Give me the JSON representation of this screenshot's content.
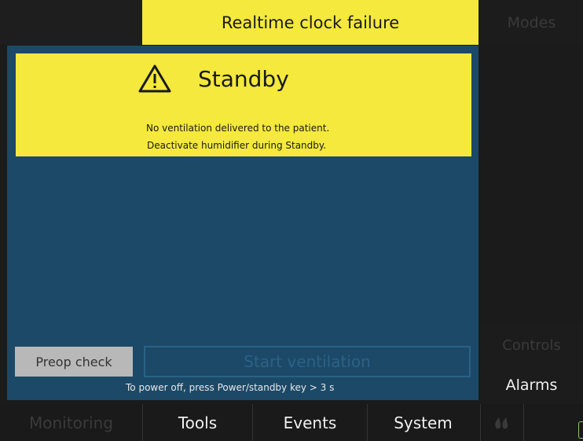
{
  "header": {
    "alarm_message": "Realtime clock failure",
    "modes_label": "Modes"
  },
  "standby": {
    "title": "Standby",
    "icon": "warning-triangle-icon",
    "messages": [
      "No ventilation delivered to the patient.",
      "Deactivate humidifier during Standby."
    ]
  },
  "actions": {
    "preop_label": "Preop check",
    "start_label": "Start ventilation",
    "power_hint": "To power off,  press Power/standby key > 3 s"
  },
  "sidebar": {
    "controls_label": "Controls",
    "alarms_label": "Alarms"
  },
  "nav": {
    "monitoring": "Monitoring",
    "tools": "Tools",
    "events": "Events",
    "system": "System",
    "drops_icon": "humidifier-drops-icon",
    "battery_icon": "battery-icon"
  },
  "colors": {
    "alarm_yellow": "#f4e93c",
    "panel_blue": "#1c4967",
    "disabled_text": "#3a3a3a"
  }
}
